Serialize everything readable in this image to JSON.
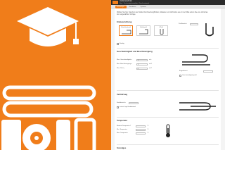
{
  "colors": {
    "accent": "#f07d1a",
    "topbar": "#2b2b2b",
    "hero": "#f07d1a"
  },
  "hero": {
    "icons": [
      "graduation-cap-icon",
      "rolled-material-icon"
    ]
  },
  "app": {
    "title": "Umformtechnik",
    "breadcrumbs": "Bau  ›  Technologietemplate  ›  Durchsetzwerk",
    "tabs": [
      "Technologie...",
      "Bearbeiten",
      "Optionen"
    ],
    "intro": "Wählen Sie hier zwischen den Stufen Durchsetzung/Rollen, Abkanten und Verbinden aus. In der Mitte sehen Sie eine Vorschau der ausgewählten Vorlage.",
    "section_profile": "Endausrichtung",
    "profiles": [
      "Schweißrand profil",
      "Stehfalzprofil",
      "U-Profil"
    ],
    "profile_field_label": "Profilbreite b",
    "profile_field_value": "",
    "profile_check_label": "Bündig",
    "section_speed": "Geschwindigkeit und Beschleunigung",
    "speed_fields": [
      {
        "label": "Max. Geschwindigkeit v",
        "value": "1",
        "unit": "m/s"
      },
      {
        "label": "Max. Beschleunigung a",
        "value": "1",
        "unit": "m/s²"
      },
      {
        "label": "Max. Ruck j",
        "value": "0",
        "unit": "m/s³"
      }
    ],
    "speed_right_label": "Eingabewert",
    "speed_right_value": "",
    "speed_right_check": "Geschwindigkeitsprofil",
    "section_process": "Verfahrweg",
    "process_field_label": "Endabstand e",
    "process_field_value": "",
    "process_check_label": "untere Lage Endabstand",
    "section_temp": "Temperatur",
    "temp_fields": [
      {
        "label": "Material-Temperatur T",
        "value": "",
        "unit": "°C"
      },
      {
        "label": "Min. Temperatur",
        "value": "",
        "unit": "°C"
      },
      {
        "label": "Max. Temperatur",
        "value": "",
        "unit": "°C"
      }
    ],
    "section_last": "Sonstiges"
  }
}
